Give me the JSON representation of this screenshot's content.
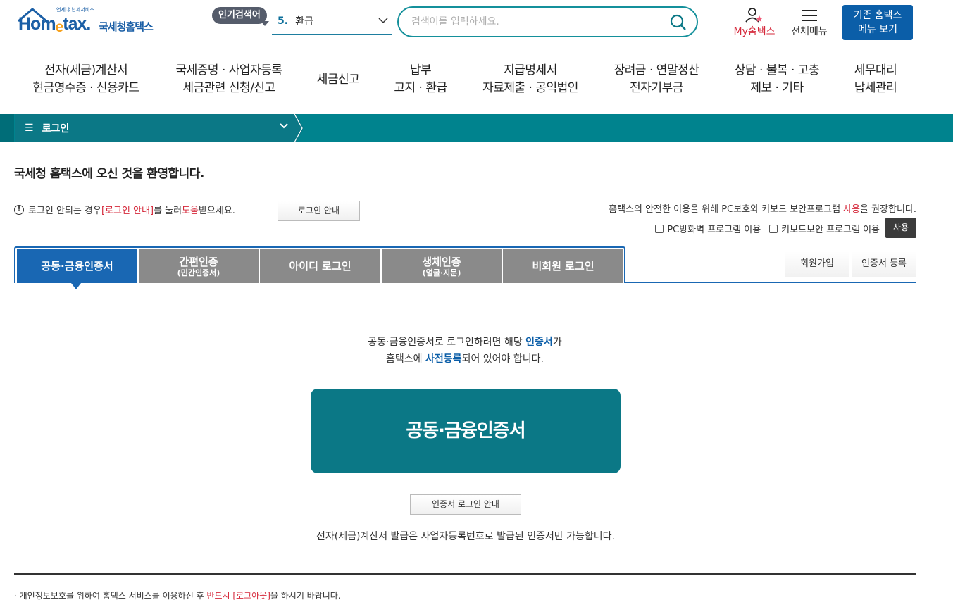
{
  "header": {
    "logo_text_pre": "Hom",
    "logo_text_e": "e",
    "logo_text_post": "tax.",
    "logo_sub": "언제냐 납세서비스",
    "logo_kr": "국세청홈택스",
    "popular_badge": "인기검색어",
    "popular_rank": "5.",
    "popular_term": "환급",
    "search_placeholder": "검색어를 입력하세요.",
    "my_label": "My홈택스",
    "allmenu_label": "전체메뉴",
    "oldmenu_line1": "기존 홈택스",
    "oldmenu_line2": "메뉴 보기"
  },
  "nav": [
    {
      "line1": "전자(세금)계산서",
      "line2": "현금영수증 · 신용카드"
    },
    {
      "line1": "국세증명 · 사업자등록",
      "line2": "세금관련 신청/신고"
    },
    {
      "line1": "세금신고",
      "line2": ""
    },
    {
      "line1": "납부",
      "line2": "고지 · 환급"
    },
    {
      "line1": "지급명세서",
      "line2": "자료제출 · 공익법인"
    },
    {
      "line1": "장려금 · 연말정산",
      "line2": "전자기부금"
    },
    {
      "line1": "상담 · 불복 · 고충",
      "line2": "제보 · 기타"
    },
    {
      "line1": "세무대리",
      "line2": "납세관리"
    }
  ],
  "breadcrumb": {
    "label": "로그인"
  },
  "welcome": "국세청 홈택스에 오신 것을 환영합니다.",
  "notice": {
    "p1": "로그인 안되는 경우 ",
    "red1": "[로그인 안내]",
    "p2": "를 눌러 ",
    "red2": "도움",
    "p3": "받으세요.",
    "button": "로그인 안내"
  },
  "security": {
    "p1": "홈택스의 안전한 이용을 위해 PC보호와 키보드 보안프로그램 ",
    "red": "사용",
    "p2": "을 권장합니다.",
    "opt1": "PC방화벽 프로그램 이용",
    "opt2": "키보드보안 프로그램 이용",
    "use_button": "사용"
  },
  "tabs": [
    {
      "label": "공동·금융인증서",
      "sub": ""
    },
    {
      "label": "간편인증",
      "sub": "(민간인증서)"
    },
    {
      "label": "아이디 로그인",
      "sub": ""
    },
    {
      "label": "생체인증",
      "sub": "(얼굴·지문)"
    },
    {
      "label": "비회원 로그인",
      "sub": ""
    }
  ],
  "side_buttons": {
    "join": "회원가입",
    "cert_register": "인증서 등록"
  },
  "content": {
    "desc1_a": "공동·금융인증서로 로그인하려면 해당 ",
    "desc1_blue": "인증서",
    "desc1_b": "가",
    "desc2_a": "홈택스에 ",
    "desc2_blue": "사전등록",
    "desc2_b": "되어 있어야 합니다.",
    "main_button": "공동·금융인증서",
    "guide_button": "인증서 로그인 안내",
    "invoice_note": "전자(세금)계산서 발급은 사업자등록번호로 발급된 인증서만 가능합니다."
  },
  "footer": {
    "p1": "개인정보보호를 위하여 홈택스 서비스를 이용하신 후 ",
    "red": "반드시 [로그아웃]",
    "p2": "을 하시기 바랍니다."
  },
  "colors": {
    "teal": "#00838e",
    "blue": "#1967b3",
    "red": "#d5293b"
  }
}
